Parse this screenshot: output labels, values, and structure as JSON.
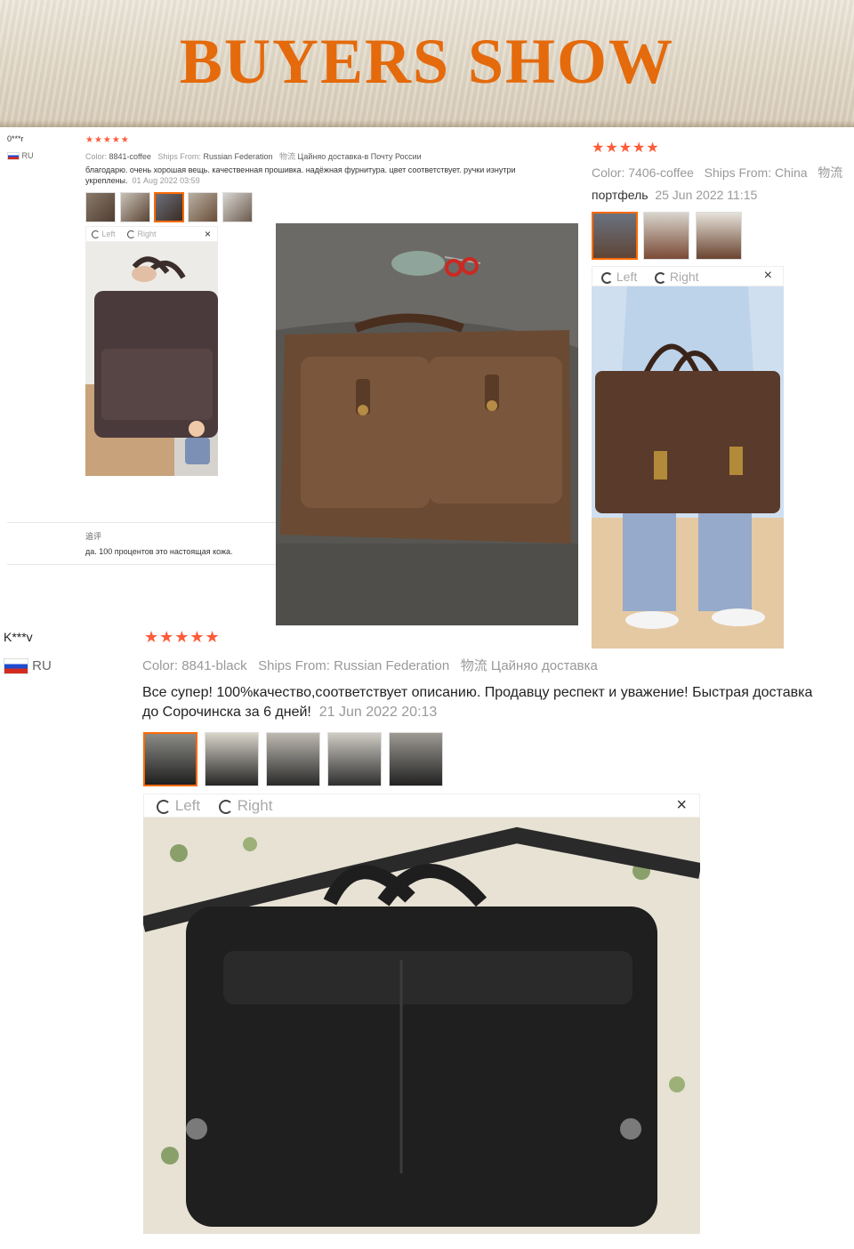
{
  "banner": {
    "title": "BUYERS SHOW"
  },
  "review1": {
    "name": "0***r",
    "country": "RU",
    "rating": "★★★★★",
    "color_label": "Color:",
    "color_value": "8841-coffee",
    "ships_label": "Ships From:",
    "ships_value": "Russian Federation",
    "delivery_label": "物流",
    "delivery_value": "Цайняо доставка-в Почту России",
    "text": "благодарю. очень хорошая вещь. качественная прошивка. надёжная фурнитура. цвет соответствует. ручки изнутри укреплены.",
    "date": "01 Aug 2022 03:59",
    "viewer": {
      "left": "Left",
      "right": "Right",
      "close": "×"
    },
    "followup_label": "追评",
    "followup_text": "да. 100 процентов это настоящая кожа."
  },
  "review2": {
    "rating": "★★★★★",
    "color_label": "Color:",
    "color_value": "7406-coffee",
    "ships_label": "Ships From:",
    "ships_value": "China",
    "delivery_label": "物流",
    "text": "портфель",
    "date": "25 Jun 2022 11:15",
    "viewer": {
      "left": "Left",
      "right": "Right",
      "close": "×"
    }
  },
  "review3": {
    "name": "K***v",
    "country": "RU",
    "rating": "★★★★★",
    "color_label": "Color:",
    "color_value": "8841-black",
    "ships_label": "Ships From:",
    "ships_value": "Russian Federation",
    "delivery_label": "物流",
    "delivery_value": "Цайняо доставка",
    "text_line1": "Все супер! 100%качество,соответствует описанию. Продавцу респект и уважение! Быстрая доставка",
    "text_line2": "до Сорочинска за 6 дней!",
    "date": "21 Jun 2022 20:13",
    "viewer": {
      "left": "Left",
      "right": "Right",
      "close": "×"
    }
  },
  "colors": {
    "accent": "#e46a0c",
    "star": "#ff5b3a",
    "selected_border": "#ff6a00"
  }
}
